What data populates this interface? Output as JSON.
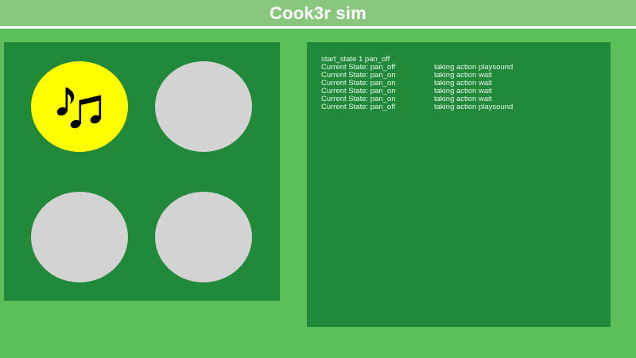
{
  "header": {
    "title": "Cook3r sim"
  },
  "pads": [
    {
      "id": "pad-1",
      "active": true,
      "icon": "music-notes-icon"
    },
    {
      "id": "pad-2",
      "active": false
    },
    {
      "id": "pad-3",
      "active": false
    },
    {
      "id": "pad-4",
      "active": false
    }
  ],
  "colors": {
    "background": "#5cbf5a",
    "header": "#8ac77e",
    "panel": "#218a3a",
    "pad_inactive": "#d3d3d3",
    "pad_active": "#ffff00"
  },
  "log": {
    "start_line": "start_state 1 pan_off",
    "entries": [
      {
        "state": "Current State: pan_off",
        "action": "taking action playsound"
      },
      {
        "state": "Current State: pan_on",
        "action": "taking action wait"
      },
      {
        "state": "Current State: pan_on",
        "action": "taking action wait"
      },
      {
        "state": "Current State: pan_on",
        "action": "taking action wait"
      },
      {
        "state": "Current State: pan_on",
        "action": "taking action wait"
      },
      {
        "state": "Current State: pan_off",
        "action": "taking action playsound"
      }
    ]
  }
}
